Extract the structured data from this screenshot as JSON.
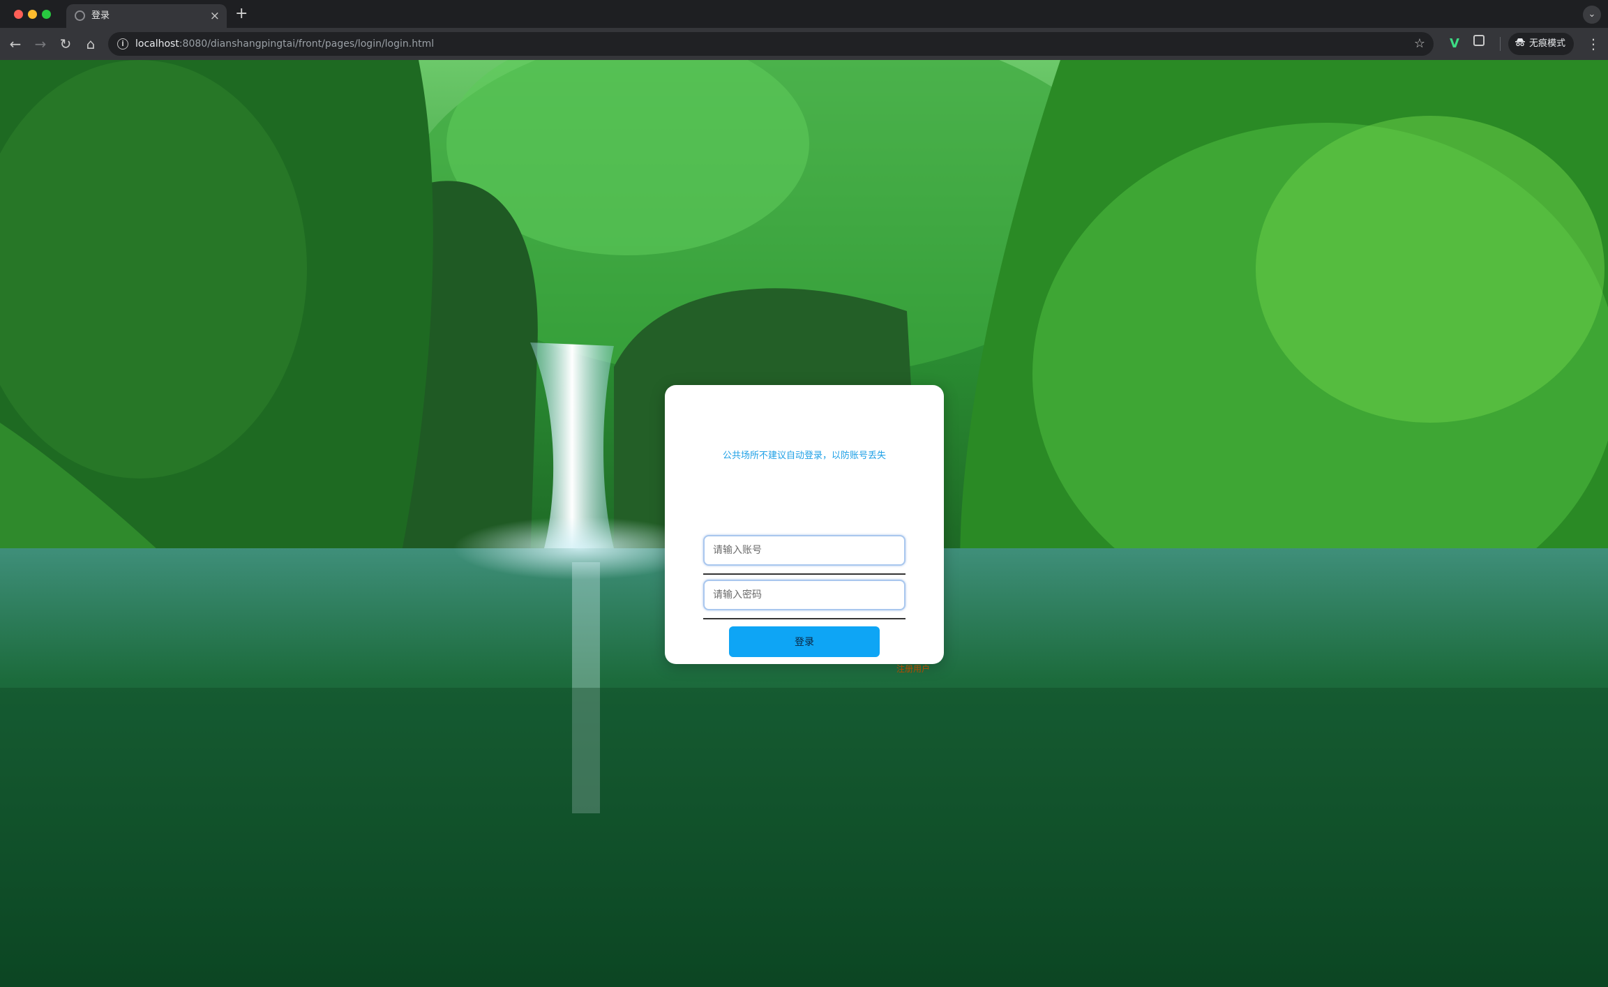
{
  "browser": {
    "tab": {
      "title": "登录",
      "close_glyph": "×"
    },
    "new_tab_glyph": "+",
    "tabs_menu_glyph": "⌄",
    "nav": {
      "back": "←",
      "forward": "→",
      "reload": "↻",
      "home": "⌂"
    },
    "address": {
      "host": "localhost",
      "path": ":8080/dianshangpingtai/front/pages/login/login.html"
    },
    "bookmark_glyph": "☆",
    "extension_label": "V",
    "incognito_label": "无痕模式",
    "menu_glyph": "⋮",
    "icons": {
      "favicon": "globe-icon",
      "info": "info-icon",
      "bookmark": "star-icon",
      "extensions": "puzzle-icon",
      "incognito": "incognito-icon",
      "menu": "kebab-menu-icon"
    }
  },
  "login": {
    "notice": "公共场所不建议自动登录，以防账号丢失",
    "account_placeholder": "请输入账号",
    "password_placeholder": "请输入密码",
    "login_button": "登录",
    "register_link": "注册用户"
  },
  "colors": {
    "notice_text": "#1ea0e6",
    "login_button_bg": "#0ea5f5",
    "register_link": "#b64a00",
    "input_border": "#a9c7ee"
  }
}
